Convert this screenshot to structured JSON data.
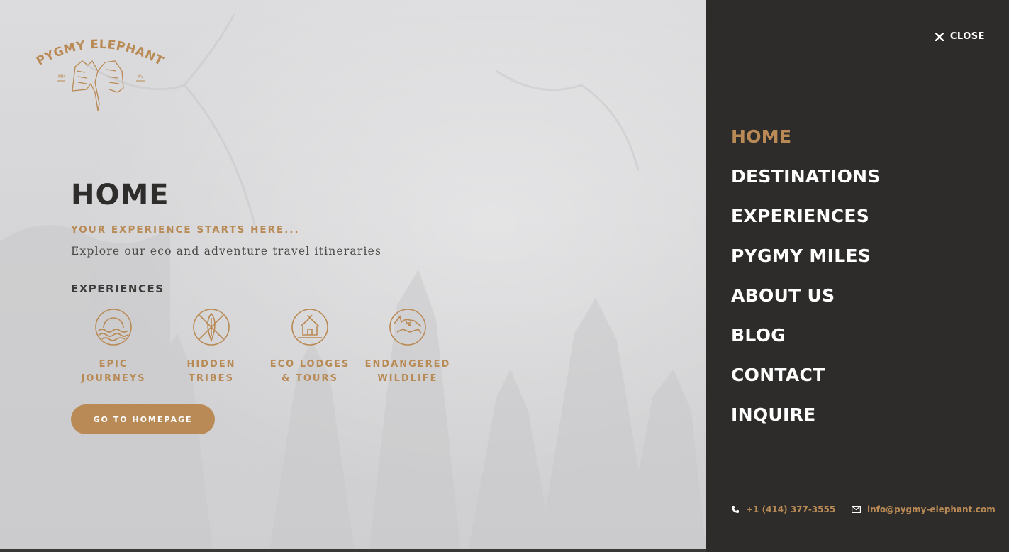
{
  "brand": {
    "name": "PYGMY ELEPHANT",
    "left_mark": "MM",
    "right_mark": "XV"
  },
  "main": {
    "title": "HOME",
    "tagline": "YOUR EXPERIENCE STARTS HERE...",
    "subtitle": "Explore our eco and adventure travel itineraries",
    "section_label": "EXPERIENCES",
    "experiences": [
      {
        "label": "EPIC\nJOURNEYS",
        "icon": "sunset-waves-icon"
      },
      {
        "label": "HIDDEN\nTRIBES",
        "icon": "shield-spears-icon"
      },
      {
        "label": "ECO LODGES\n& TOURS",
        "icon": "hut-icon"
      },
      {
        "label": "ENDANGERED\nWILDLIFE",
        "icon": "rhino-icon"
      }
    ],
    "cta_label": "GO TO HOMEPAGE"
  },
  "menu": {
    "close_label": "CLOSE",
    "items": [
      {
        "label": "HOME",
        "active": true
      },
      {
        "label": "DESTINATIONS",
        "active": false
      },
      {
        "label": "EXPERIENCES",
        "active": false
      },
      {
        "label": "PYGMY MILES",
        "active": false
      },
      {
        "label": "ABOUT US",
        "active": false
      },
      {
        "label": "BLOG",
        "active": false
      },
      {
        "label": "CONTACT",
        "active": false
      },
      {
        "label": "INQUIRE",
        "active": false
      }
    ],
    "phone": "+1 (414) 377-3555",
    "email": "info@pygmy-elephant.com"
  },
  "colors": {
    "accent": "#b98a55",
    "panel": "#2d2c2a",
    "title": "#2e2d2b"
  }
}
